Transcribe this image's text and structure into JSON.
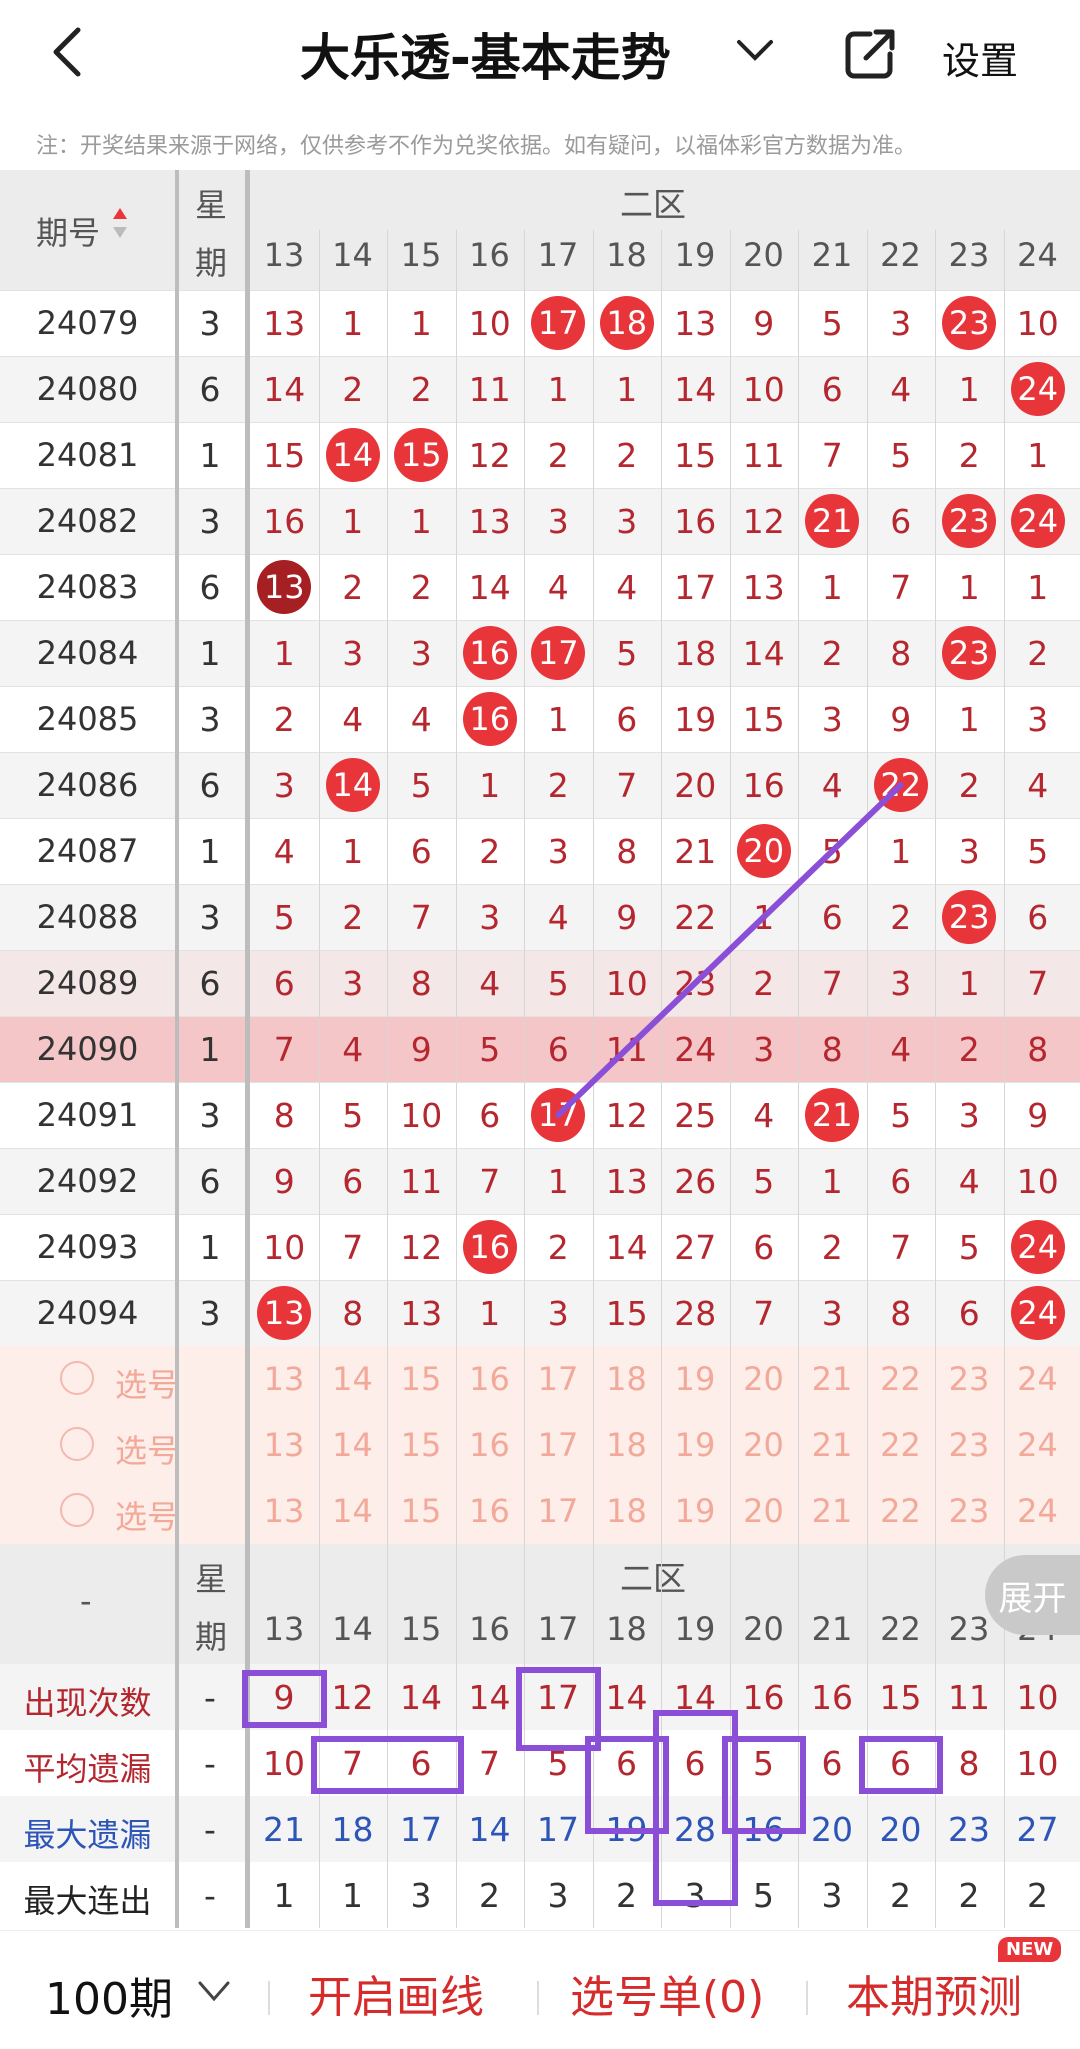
{
  "header": {
    "title": "大乐透-基本走势",
    "settings_label": "设置"
  },
  "notice": "注：开奖结果来源于网络，仅供参考不作为兑奖依据。如有疑问，以福体彩官方数据为准。",
  "table": {
    "issue_header": "期号",
    "week_header_top": "星",
    "week_header_bottom": "期",
    "zone_label": "二区",
    "columns": [
      "13",
      "14",
      "15",
      "16",
      "17",
      "18",
      "19",
      "20",
      "21",
      "22",
      "23",
      "24"
    ],
    "rows": [
      {
        "issue": "24079",
        "week": "3",
        "cells": [
          "13",
          "1",
          "1",
          "10",
          "17",
          "18",
          "13",
          "9",
          "5",
          "3",
          "23",
          "10"
        ],
        "hits": [
          4,
          5,
          10
        ]
      },
      {
        "issue": "24080",
        "week": "6",
        "cells": [
          "14",
          "2",
          "2",
          "11",
          "1",
          "1",
          "14",
          "10",
          "6",
          "4",
          "1",
          "24"
        ],
        "hits": [
          11
        ]
      },
      {
        "issue": "24081",
        "week": "1",
        "cells": [
          "15",
          "14",
          "15",
          "12",
          "2",
          "2",
          "15",
          "11",
          "7",
          "5",
          "2",
          "1"
        ],
        "hits": [
          1,
          2
        ]
      },
      {
        "issue": "24082",
        "week": "3",
        "cells": [
          "16",
          "1",
          "1",
          "13",
          "3",
          "3",
          "16",
          "12",
          "21",
          "6",
          "23",
          "24"
        ],
        "hits": [
          8,
          10,
          11
        ]
      },
      {
        "issue": "24083",
        "week": "6",
        "cells": [
          "13",
          "2",
          "2",
          "14",
          "4",
          "4",
          "17",
          "13",
          "1",
          "7",
          "1",
          "1"
        ],
        "hits": [
          0
        ],
        "dark": [
          0
        ]
      },
      {
        "issue": "24084",
        "week": "1",
        "cells": [
          "1",
          "3",
          "3",
          "16",
          "17",
          "5",
          "18",
          "14",
          "2",
          "8",
          "23",
          "2"
        ],
        "hits": [
          3,
          4,
          10
        ]
      },
      {
        "issue": "24085",
        "week": "3",
        "cells": [
          "2",
          "4",
          "4",
          "16",
          "1",
          "6",
          "19",
          "15",
          "3",
          "9",
          "1",
          "3"
        ],
        "hits": [
          3
        ]
      },
      {
        "issue": "24086",
        "week": "6",
        "cells": [
          "3",
          "14",
          "5",
          "1",
          "2",
          "7",
          "20",
          "16",
          "4",
          "22",
          "2",
          "4"
        ],
        "hits": [
          1,
          9
        ]
      },
      {
        "issue": "24087",
        "week": "1",
        "cells": [
          "4",
          "1",
          "6",
          "2",
          "3",
          "8",
          "21",
          "20",
          "5",
          "1",
          "3",
          "5"
        ],
        "hits": [
          7
        ]
      },
      {
        "issue": "24088",
        "week": "3",
        "cells": [
          "5",
          "2",
          "7",
          "3",
          "4",
          "9",
          "22",
          "1",
          "6",
          "2",
          "23",
          "6"
        ],
        "hits": [
          10
        ]
      },
      {
        "issue": "24089",
        "week": "6",
        "cells": [
          "6",
          "3",
          "8",
          "4",
          "5",
          "10",
          "23",
          "2",
          "7",
          "3",
          "1",
          "7"
        ],
        "hits": []
      },
      {
        "issue": "24090",
        "week": "1",
        "cells": [
          "7",
          "4",
          "9",
          "5",
          "6",
          "11",
          "24",
          "3",
          "8",
          "4",
          "2",
          "8"
        ],
        "hits": []
      },
      {
        "issue": "24091",
        "week": "3",
        "cells": [
          "8",
          "5",
          "10",
          "6",
          "17",
          "12",
          "25",
          "4",
          "21",
          "5",
          "3",
          "9"
        ],
        "hits": [
          4,
          8
        ]
      },
      {
        "issue": "24092",
        "week": "6",
        "cells": [
          "9",
          "6",
          "11",
          "7",
          "1",
          "13",
          "26",
          "5",
          "1",
          "6",
          "4",
          "10"
        ],
        "hits": []
      },
      {
        "issue": "24093",
        "week": "1",
        "cells": [
          "10",
          "7",
          "12",
          "16",
          "2",
          "14",
          "27",
          "6",
          "2",
          "7",
          "5",
          "24"
        ],
        "hits": [
          3,
          11
        ]
      },
      {
        "issue": "24094",
        "week": "3",
        "cells": [
          "13",
          "8",
          "13",
          "1",
          "3",
          "15",
          "28",
          "7",
          "3",
          "8",
          "6",
          "24"
        ],
        "hits": [
          0,
          11
        ]
      }
    ]
  },
  "pick": {
    "label": "选号",
    "rows": 3
  },
  "stats": {
    "dash": "-",
    "rows": [
      {
        "label": "出现次数",
        "color": "red",
        "values": [
          "9",
          "12",
          "14",
          "14",
          "17",
          "14",
          "14",
          "16",
          "16",
          "15",
          "11",
          "10"
        ]
      },
      {
        "label": "平均遗漏",
        "color": "red",
        "values": [
          "10",
          "7",
          "6",
          "7",
          "5",
          "6",
          "6",
          "5",
          "6",
          "6",
          "8",
          "10"
        ]
      },
      {
        "label": "最大遗漏",
        "color": "blue",
        "values": [
          "21",
          "18",
          "17",
          "14",
          "17",
          "19",
          "28",
          "16",
          "20",
          "20",
          "23",
          "27"
        ]
      },
      {
        "label": "最大连出",
        "color": "plain",
        "values": [
          "1",
          "1",
          "3",
          "2",
          "3",
          "2",
          "3",
          "5",
          "3",
          "2",
          "2",
          "2"
        ]
      }
    ]
  },
  "expand_label": "展开",
  "bottom": {
    "period": "100期",
    "draw_line": "开启画线",
    "pick_list": "选号单(0)",
    "predict": "本期预测",
    "new_badge": "NEW"
  }
}
